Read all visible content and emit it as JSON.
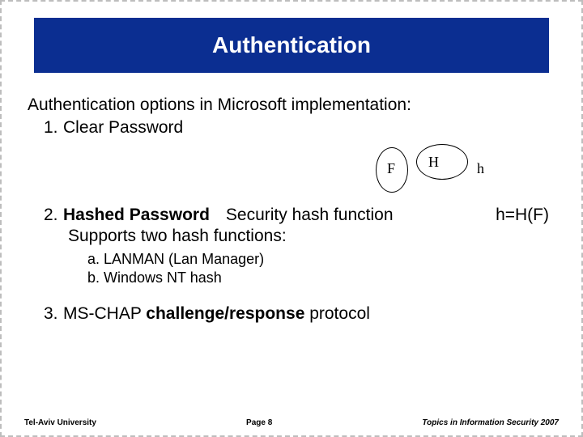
{
  "title": "Authentication",
  "intro": "Authentication options in Microsoft implementation:",
  "items": {
    "one": {
      "num": "1.",
      "label": "Clear Password"
    },
    "two": {
      "num": "2.",
      "label_strong": "Hashed Password",
      "mid": "Security hash function",
      "eq": "h=H(F)",
      "supports": "Supports two hash functions:"
    },
    "sub": {
      "a": {
        "num": "a.",
        "label": "LANMAN (Lan Manager)"
      },
      "b": {
        "num": "b.",
        "label": "Windows NT hash"
      }
    },
    "three": {
      "num": "3.",
      "pre": "MS-CHAP ",
      "strong": "challenge/response",
      "post": " protocol"
    }
  },
  "diagram": {
    "F": "F",
    "H": "H",
    "h": "h"
  },
  "footer": {
    "left": "Tel-Aviv University",
    "center": "Page 8",
    "right": "Topics in Information Security 2007"
  }
}
